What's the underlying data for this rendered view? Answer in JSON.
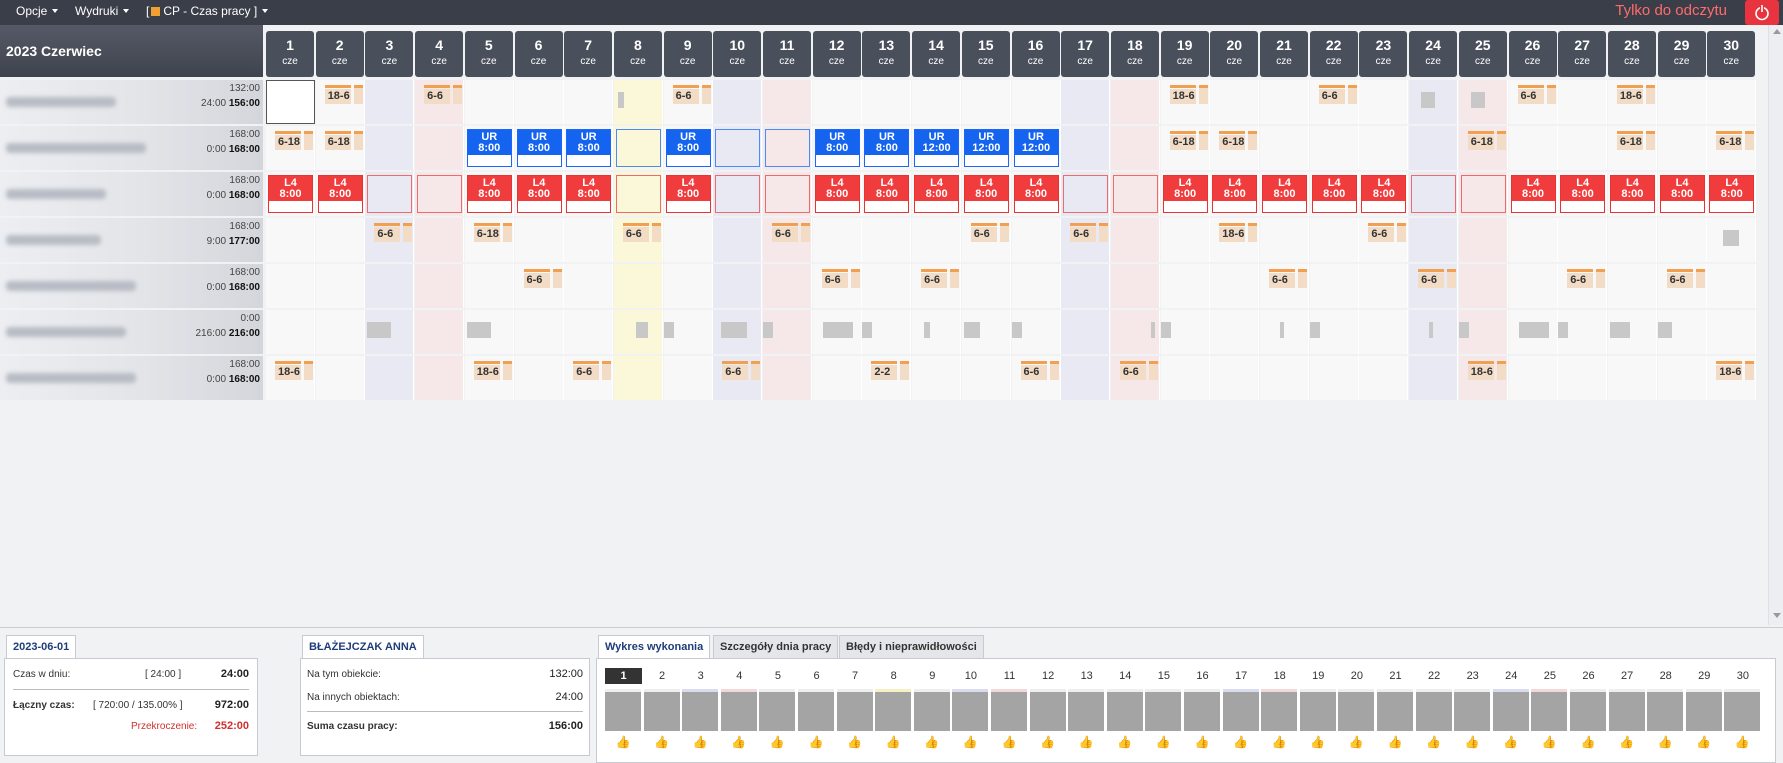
{
  "topbar": {
    "menu_opcje": "Opcje",
    "menu_wydruki": "Wydruki",
    "menu_cp_open": "[",
    "menu_cp_label": "CP - Czas pracy",
    "menu_cp_close": "]",
    "readonly": "Tylko do odczytu",
    "accent": "#e8343f"
  },
  "grid": {
    "month_title": "2023 Czerwiec",
    "days": [
      {
        "n": "1",
        "d": "cze"
      },
      {
        "n": "2",
        "d": "cze"
      },
      {
        "n": "3",
        "d": "cze"
      },
      {
        "n": "4",
        "d": "cze"
      },
      {
        "n": "5",
        "d": "cze"
      },
      {
        "n": "6",
        "d": "cze"
      },
      {
        "n": "7",
        "d": "cze"
      },
      {
        "n": "8",
        "d": "cze"
      },
      {
        "n": "9",
        "d": "cze"
      },
      {
        "n": "10",
        "d": "cze"
      },
      {
        "n": "11",
        "d": "cze"
      },
      {
        "n": "12",
        "d": "cze"
      },
      {
        "n": "13",
        "d": "cze"
      },
      {
        "n": "14",
        "d": "cze"
      },
      {
        "n": "15",
        "d": "cze"
      },
      {
        "n": "16",
        "d": "cze"
      },
      {
        "n": "17",
        "d": "cze"
      },
      {
        "n": "18",
        "d": "cze"
      },
      {
        "n": "19",
        "d": "cze"
      },
      {
        "n": "20",
        "d": "cze"
      },
      {
        "n": "21",
        "d": "cze"
      },
      {
        "n": "22",
        "d": "cze"
      },
      {
        "n": "23",
        "d": "cze"
      },
      {
        "n": "24",
        "d": "cze"
      },
      {
        "n": "25",
        "d": "cze"
      },
      {
        "n": "26",
        "d": "cze"
      },
      {
        "n": "27",
        "d": "cze"
      },
      {
        "n": "28",
        "d": "cze"
      },
      {
        "n": "29",
        "d": "cze"
      },
      {
        "n": "30",
        "d": "cze"
      }
    ],
    "rows": [
      {
        "top": "132:00",
        "bot_a": "24:00",
        "bot_b": "156:00",
        "cells": {
          "2": "18-6",
          "4": "6-6",
          "9": "6-6",
          "19": "18-6",
          "22": "6-6",
          "26": "6-6",
          "28": "18-6"
        }
      },
      {
        "top": "168:00",
        "bot_a": "0:00",
        "bot_b": "168:00",
        "cells": {
          "1": "6-18",
          "2": "6-18",
          "5": "UR|8:00",
          "6": "UR|8:00",
          "7": "UR|8:00",
          "9": "UR|8:00",
          "12": "UR|8:00",
          "13": "UR|8:00",
          "14": "UR|12:00",
          "15": "UR|12:00",
          "16": "UR|12:00",
          "19": "6-18",
          "20": "6-18",
          "25": "6-18",
          "28": "6-18",
          "30": "6-18"
        }
      },
      {
        "top": "168:00",
        "bot_a": "0:00",
        "bot_b": "168:00",
        "cells": {
          "1": "L4|8:00",
          "2": "L4|8:00",
          "5": "L4|8:00",
          "6": "L4|8:00",
          "7": "L4|8:00",
          "9": "L4|8:00",
          "12": "L4|8:00",
          "13": "L4|8:00",
          "14": "L4|8:00",
          "15": "L4|8:00",
          "16": "L4|8:00",
          "19": "L4|8:00",
          "20": "L4|8:00",
          "21": "L4|8:00",
          "22": "L4|8:00",
          "23": "L4|8:00",
          "26": "L4|8:00",
          "27": "L4|8:00",
          "28": "L4|8:00",
          "29": "L4|8:00",
          "30": "L4|8:00"
        }
      },
      {
        "top": "168:00",
        "bot_a": "9:00",
        "bot_b": "177:00",
        "cells": {
          "3": "6-6",
          "5": "6-18",
          "8": "6-6",
          "11": "6-6",
          "15": "6-6",
          "17": "6-6",
          "20": "18-6",
          "23": "6-6"
        }
      },
      {
        "top": "168:00",
        "bot_a": "0:00",
        "bot_b": "168:00",
        "cells": {
          "6": "6-6",
          "12": "6-6",
          "14": "6-6",
          "21": "6-6",
          "24": "6-6",
          "27": "6-6",
          "29": "6-6"
        }
      },
      {
        "top": "0:00",
        "bot_a": "216:00",
        "bot_b": "216:00",
        "cells": {}
      },
      {
        "top": "168:00",
        "bot_a": "0:00",
        "bot_b": "168:00",
        "cells": {
          "1": "18-6",
          "5": "18-6",
          "7": "6-6",
          "10": "6-6",
          "13": "2-2",
          "16": "6-6",
          "18": "6-6",
          "25": "18-6",
          "30": "18-6"
        }
      }
    ]
  },
  "bottom": {
    "date_tab": "2023-06-01",
    "czas_w_dniu_label": "Czas w dniu:",
    "czas_w_dniu_mid": "[ 24:00 ]",
    "czas_w_dniu_val": "24:00",
    "laczny_label": "Łączny czas:",
    "laczny_mid": "[ 720:00 / 135.00% ]",
    "laczny_val": "972:00",
    "przekroczenie_label": "Przekroczenie:",
    "przekroczenie_val": "252:00",
    "person_tab": "BŁAŻEJCZAK ANNA",
    "na_tym_label": "Na tym obiekcie:",
    "na_tym_val": "132:00",
    "na_innych_label": "Na innych obiektach:",
    "na_innych_val": "24:00",
    "suma_label": "Suma czasu pracy:",
    "suma_val": "156:00",
    "tab_wykres": "Wykres wykonania",
    "tab_szczegoly": "Szczegóły dnia pracy",
    "tab_bledy": "Błędy i nieprawidłowości",
    "selected_day": "1",
    "thumb_glyph": "👍"
  }
}
